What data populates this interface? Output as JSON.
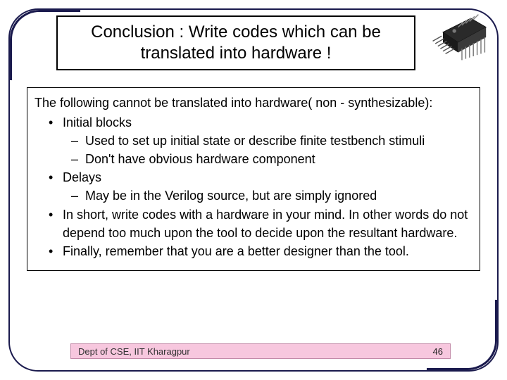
{
  "title": "Conclusion : Write codes which can be translated into hardware !",
  "content": {
    "lead": "The following cannot be translated into hardware( non - synthesizable):",
    "items": [
      {
        "text": "Initial blocks",
        "sub": [
          "Used to set up initial state or describe finite testbench stimuli",
          "Don't have obvious hardware component"
        ]
      },
      {
        "text": "Delays",
        "sub": [
          "May be in the Verilog source, but are simply ignored"
        ]
      },
      {
        "text": "In short,  write codes with a hardware in your mind. In other words do not depend too much upon the tool to decide upon the resultant hardware.",
        "sub": []
      },
      {
        "text": "Finally, remember that you are a better designer than the tool.",
        "sub": []
      }
    ]
  },
  "footer": {
    "dept": "Dept of CSE, IIT Kharagpur",
    "page": "46"
  },
  "icon": {
    "name": "microprocessor-chip"
  }
}
